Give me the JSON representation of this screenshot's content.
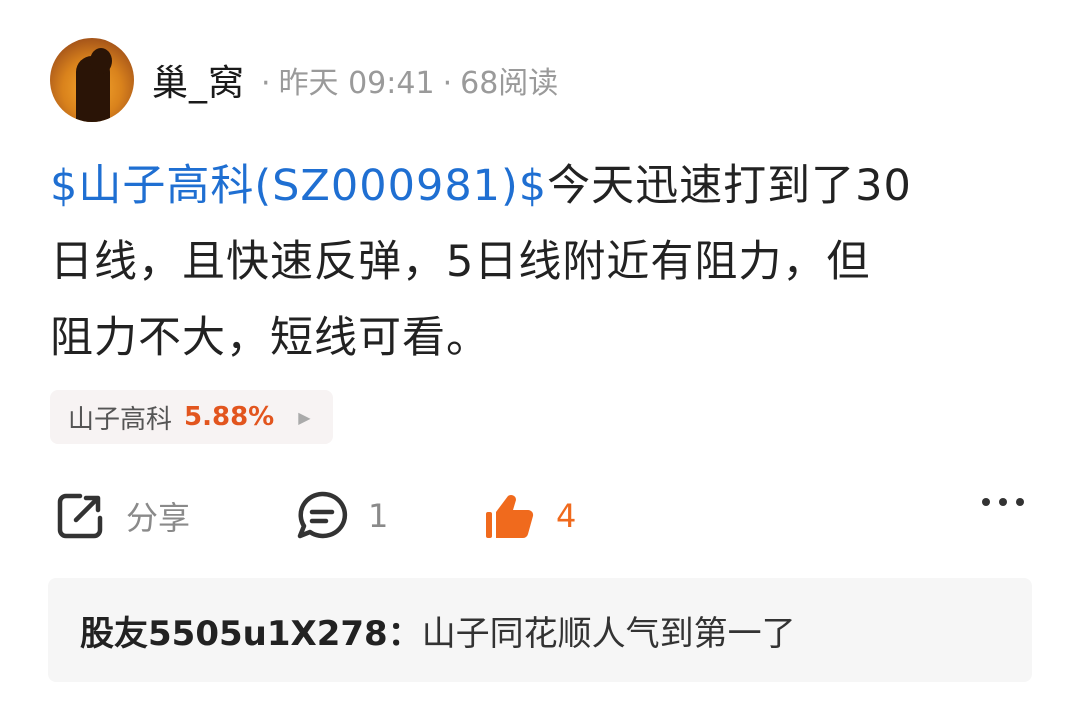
{
  "post": {
    "author": "巢_窝",
    "sep1": "·",
    "time": "昨天 09:41",
    "sep2": "·",
    "reads": "68阅读",
    "stock_link": "$山子高科(SZ000981)$",
    "body_line1": "今天迅速打到了30",
    "body_line2": "日线，且快速反弹，5日线附近有阻力，但",
    "body_line3": "阻力不大，短线可看。"
  },
  "stock_chip": {
    "name": "山子高科",
    "change": "5.88%",
    "arrow_icon": "play-arrow-icon",
    "change_color": "#e2551e"
  },
  "actions": {
    "share_label": "分享",
    "comment_count": "1",
    "like_count": "4",
    "like_color": "#f06a1d"
  },
  "comment_preview": {
    "user": "股友5505u1X278：",
    "text": "山子同花顺人气到第一了"
  },
  "colors": {
    "link": "#1f6fd2",
    "meta": "#9a9a9a"
  }
}
